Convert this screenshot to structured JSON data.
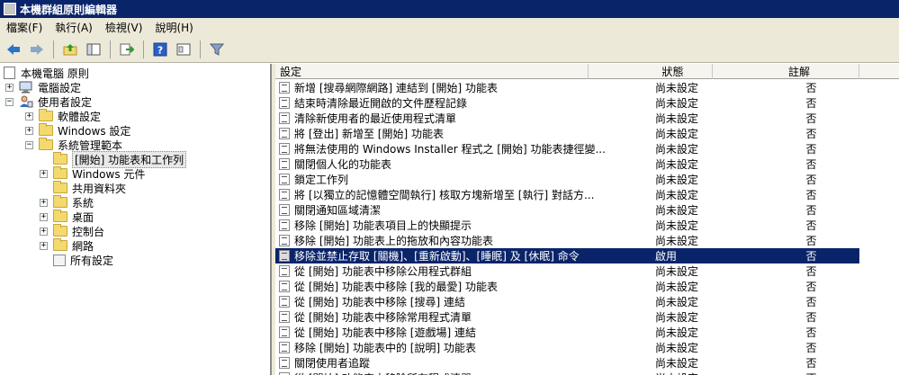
{
  "window": {
    "title": "本機群組原則編輯器"
  },
  "menu": [
    "檔案(F)",
    "執行(A)",
    "檢視(V)",
    "說明(H)"
  ],
  "tree": {
    "root": "本機電腦 原則",
    "nodes": [
      {
        "label": "電腦設定",
        "expander": "+"
      },
      {
        "label": "使用者設定",
        "expander": "−"
      },
      {
        "label": "軟體設定",
        "expander": "+"
      },
      {
        "label": "Windows 設定",
        "expander": "+"
      },
      {
        "label": "系統管理範本",
        "expander": "−"
      },
      {
        "label": "[開始] 功能表和工作列",
        "expander": ""
      },
      {
        "label": "Windows 元件",
        "expander": "+"
      },
      {
        "label": "共用資料夾",
        "expander": ""
      },
      {
        "label": "系統",
        "expander": "+"
      },
      {
        "label": "桌面",
        "expander": "+"
      },
      {
        "label": "控制台",
        "expander": "+"
      },
      {
        "label": "網路",
        "expander": "+"
      },
      {
        "label": "所有設定",
        "expander": ""
      }
    ]
  },
  "list": {
    "headers": {
      "setting": "設定",
      "state": "狀態",
      "comment": "註解"
    },
    "rows": [
      {
        "name": "新增 [搜尋網際網路] 連結到 [開始] 功能表",
        "state": "尚未設定",
        "comment": "否"
      },
      {
        "name": "結束時清除最近開啟的文件歷程記錄",
        "state": "尚未設定",
        "comment": "否"
      },
      {
        "name": "清除新使用者的最近使用程式清單",
        "state": "尚未設定",
        "comment": "否"
      },
      {
        "name": "將 [登出] 新增至 [開始] 功能表",
        "state": "尚未設定",
        "comment": "否"
      },
      {
        "name": "將無法使用的 Windows Installer 程式之 [開始] 功能表捷徑變...",
        "state": "尚未設定",
        "comment": "否"
      },
      {
        "name": "關閉個人化的功能表",
        "state": "尚未設定",
        "comment": "否"
      },
      {
        "name": "鎖定工作列",
        "state": "尚未設定",
        "comment": "否"
      },
      {
        "name": "將 [以獨立的記憶體空間執行] 核取方塊新增至 [執行] 對話方...",
        "state": "尚未設定",
        "comment": "否"
      },
      {
        "name": "關閉通知區域清潔",
        "state": "尚未設定",
        "comment": "否"
      },
      {
        "name": "移除 [開始] 功能表項目上的快顯提示",
        "state": "尚未設定",
        "comment": "否"
      },
      {
        "name": "移除 [開始] 功能表上的拖放和內容功能表",
        "state": "尚未設定",
        "comment": "否"
      },
      {
        "name": "移除並禁止存取 [關機]、[重新啟動]、[睡眠] 及 [休眠] 命令",
        "state": "啟用",
        "comment": "否"
      },
      {
        "name": "從 [開始] 功能表中移除公用程式群組",
        "state": "尚未設定",
        "comment": "否"
      },
      {
        "name": "從 [開始] 功能表中移除 [我的最愛] 功能表",
        "state": "尚未設定",
        "comment": "否"
      },
      {
        "name": "從 [開始] 功能表中移除 [搜尋] 連結",
        "state": "尚未設定",
        "comment": "否"
      },
      {
        "name": "從 [開始] 功能表中移除常用程式清單",
        "state": "尚未設定",
        "comment": "否"
      },
      {
        "name": "從 [開始] 功能表中移除 [遊戲場] 連結",
        "state": "尚未設定",
        "comment": "否"
      },
      {
        "name": "移除 [開始] 功能表中的 [說明] 功能表",
        "state": "尚未設定",
        "comment": "否"
      },
      {
        "name": "關閉使用者追蹤",
        "state": "尚未設定",
        "comment": "否"
      },
      {
        "name": "從 [開始] 功能表中移除所有程式清單",
        "state": "尚未設定",
        "comment": "否"
      }
    ]
  }
}
